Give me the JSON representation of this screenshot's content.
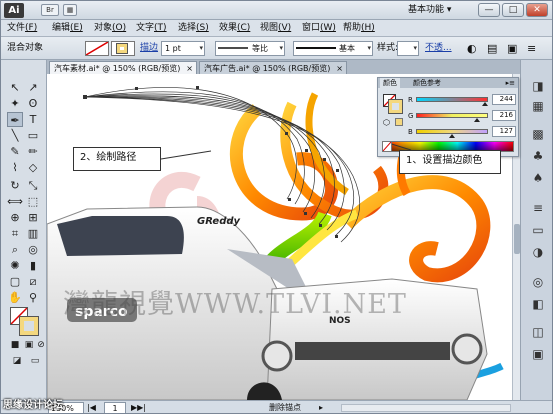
{
  "app": {
    "logo": "Ai",
    "workspace": "基本功能",
    "window_buttons": [
      "—",
      "□",
      "✕"
    ],
    "title_icons": [
      "Br",
      "▦"
    ]
  },
  "menu": [
    "文件",
    "编辑",
    "对象",
    "文字",
    "选择",
    "效果",
    "视图",
    "窗口",
    "帮助"
  ],
  "menu_hotkeys": [
    "(F)",
    "(E)",
    "(O)",
    "(T)",
    "(S)",
    "(C)",
    "(V)",
    "(W)",
    "(H)"
  ],
  "control_bar": {
    "selection_label": "混合对象",
    "stroke_label": "描边",
    "stroke_weight": "1 pt",
    "profile_label": "等比",
    "brush_label": "基本",
    "style_label": "样式:",
    "opacity_link": "不透..."
  },
  "tabs": [
    {
      "title": "汽车素材.ai* @ 150% (RGB/预览)",
      "close": "×"
    },
    {
      "title": "汽车广告.ai* @ 150% (RGB/预览)",
      "close": "×"
    }
  ],
  "color_panel": {
    "tab_color": "颜色",
    "tab_guide": "颜色参考",
    "menu": "▸≡",
    "rows": [
      {
        "label": "R",
        "value": "244",
        "gradient": "linear-gradient(to right,#00d8ff,#ff3030)",
        "pos": 0.957
      },
      {
        "label": "G",
        "value": "216",
        "gradient": "linear-gradient(to right,#ff2020,#f0f060,#ffff80)",
        "pos": 0.847
      },
      {
        "label": "B",
        "value": "127",
        "gradient": "linear-gradient(to right,#f0d000,#f0d880,#c0a0ff)",
        "pos": 0.498
      }
    ],
    "stroke_color": "#f4d87f"
  },
  "callouts": {
    "draw_path": "2、绘制路径",
    "set_stroke": "1、设置描边颜色"
  },
  "watermark": {
    "main": "灣龍視覺WWW.TLVI.NET",
    "bottom": "思缘设计论坛"
  },
  "status": {
    "zoom": "150%",
    "page": "1",
    "text": "删除锚点"
  },
  "artwork": {
    "car_brand_1": "GReddy",
    "car_brand_2": "sparco",
    "car_brand_3": "NOS"
  }
}
